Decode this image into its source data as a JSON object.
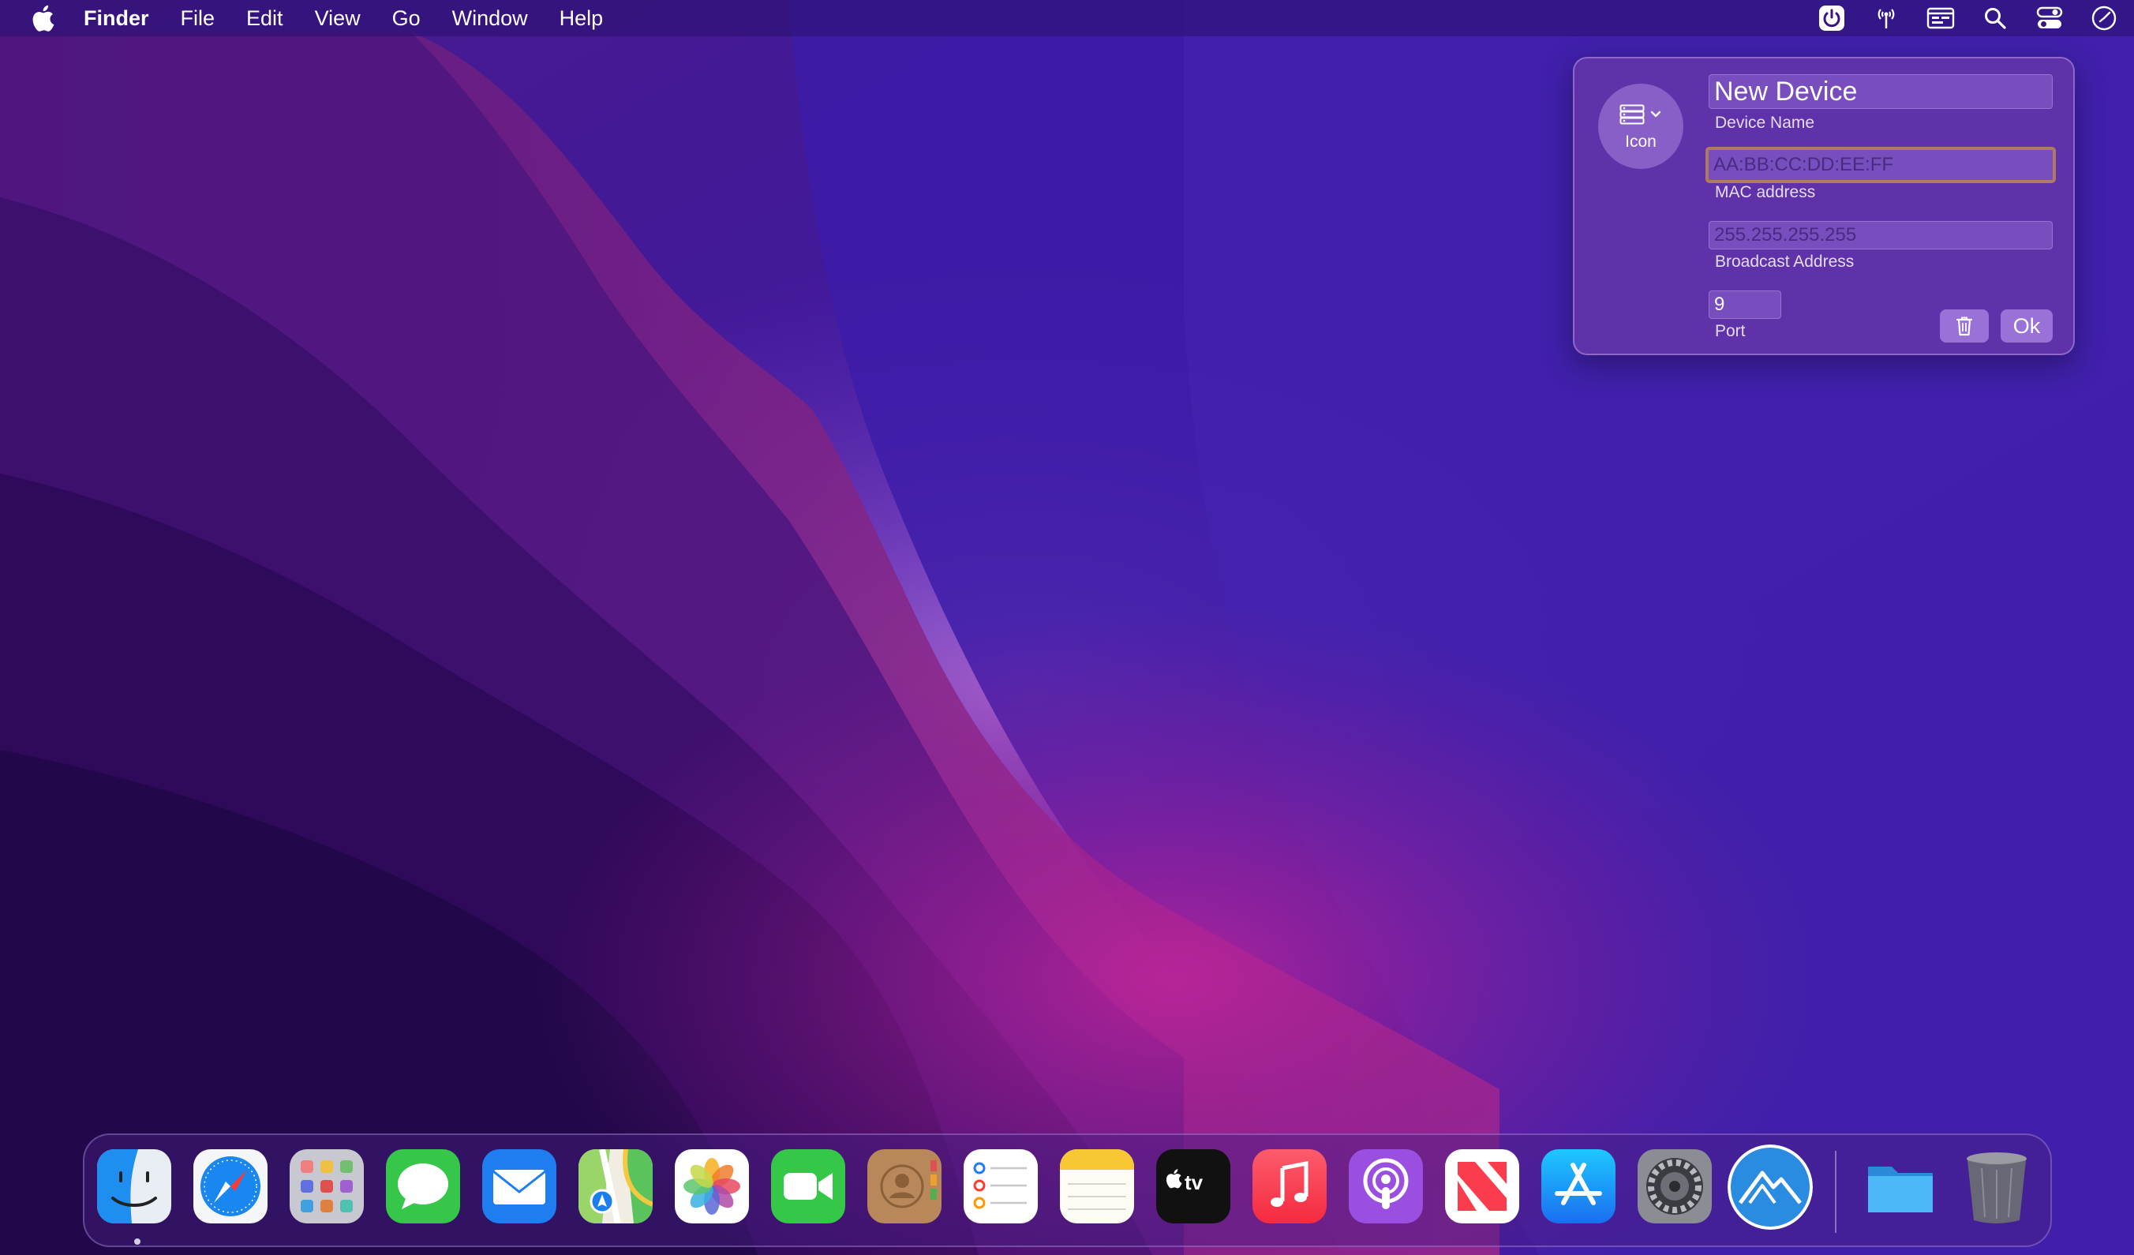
{
  "menubar": {
    "apple_icon": "apple-logo-icon",
    "app_name": "Finder",
    "items": [
      "File",
      "Edit",
      "View",
      "Go",
      "Window",
      "Help"
    ],
    "status_icons": [
      "wake-power-icon",
      "network-antenna-icon",
      "display-window-icon",
      "search-icon",
      "control-center-icon",
      "clock-icon"
    ]
  },
  "panel": {
    "icon_label": "Icon",
    "device_name": {
      "value": "New Device",
      "label": "Device Name"
    },
    "mac_address": {
      "placeholder": "AA:BB:CC:DD:EE:FF",
      "label": "MAC address"
    },
    "broadcast_address": {
      "placeholder": "255.255.255.255",
      "label": "Broadcast Address"
    },
    "port": {
      "value": "9",
      "label": "Port"
    },
    "delete_icon": "trash-icon",
    "ok_label": "Ok"
  },
  "dock": {
    "apps": [
      {
        "name": "finder-app",
        "icon": "finder-icon"
      },
      {
        "name": "safari-app",
        "icon": "safari-icon"
      },
      {
        "name": "launchpad-app",
        "icon": "launchpad-icon"
      },
      {
        "name": "messages-app",
        "icon": "messages-icon"
      },
      {
        "name": "mail-app",
        "icon": "mail-icon"
      },
      {
        "name": "maps-app",
        "icon": "maps-icon"
      },
      {
        "name": "photos-app",
        "icon": "photos-icon"
      },
      {
        "name": "facetime-app",
        "icon": "facetime-icon"
      },
      {
        "name": "contacts-app",
        "icon": "contacts-icon"
      },
      {
        "name": "reminders-app",
        "icon": "reminders-icon"
      },
      {
        "name": "notes-app",
        "icon": "notes-icon"
      },
      {
        "name": "tv-app",
        "icon": "apple-tv-icon"
      },
      {
        "name": "music-app",
        "icon": "music-icon"
      },
      {
        "name": "podcasts-app",
        "icon": "podcasts-icon"
      },
      {
        "name": "news-app",
        "icon": "news-icon"
      },
      {
        "name": "app-store-app",
        "icon": "app-store-icon"
      },
      {
        "name": "system-preferences-app",
        "icon": "system-preferences-icon"
      },
      {
        "name": "wake-app",
        "icon": "mountain-logo-icon"
      }
    ],
    "folder_icon": "downloads-folder-icon",
    "trash_icon": "trash-bin-icon",
    "tv_text": "tv"
  },
  "colors": {
    "menubar_text": "#ffffff",
    "panel_bg": "#6234a8",
    "focus_ring": "#b07a62",
    "wallpaper_magenta": "#c0249a",
    "wallpaper_deep": "#2a0c60"
  }
}
